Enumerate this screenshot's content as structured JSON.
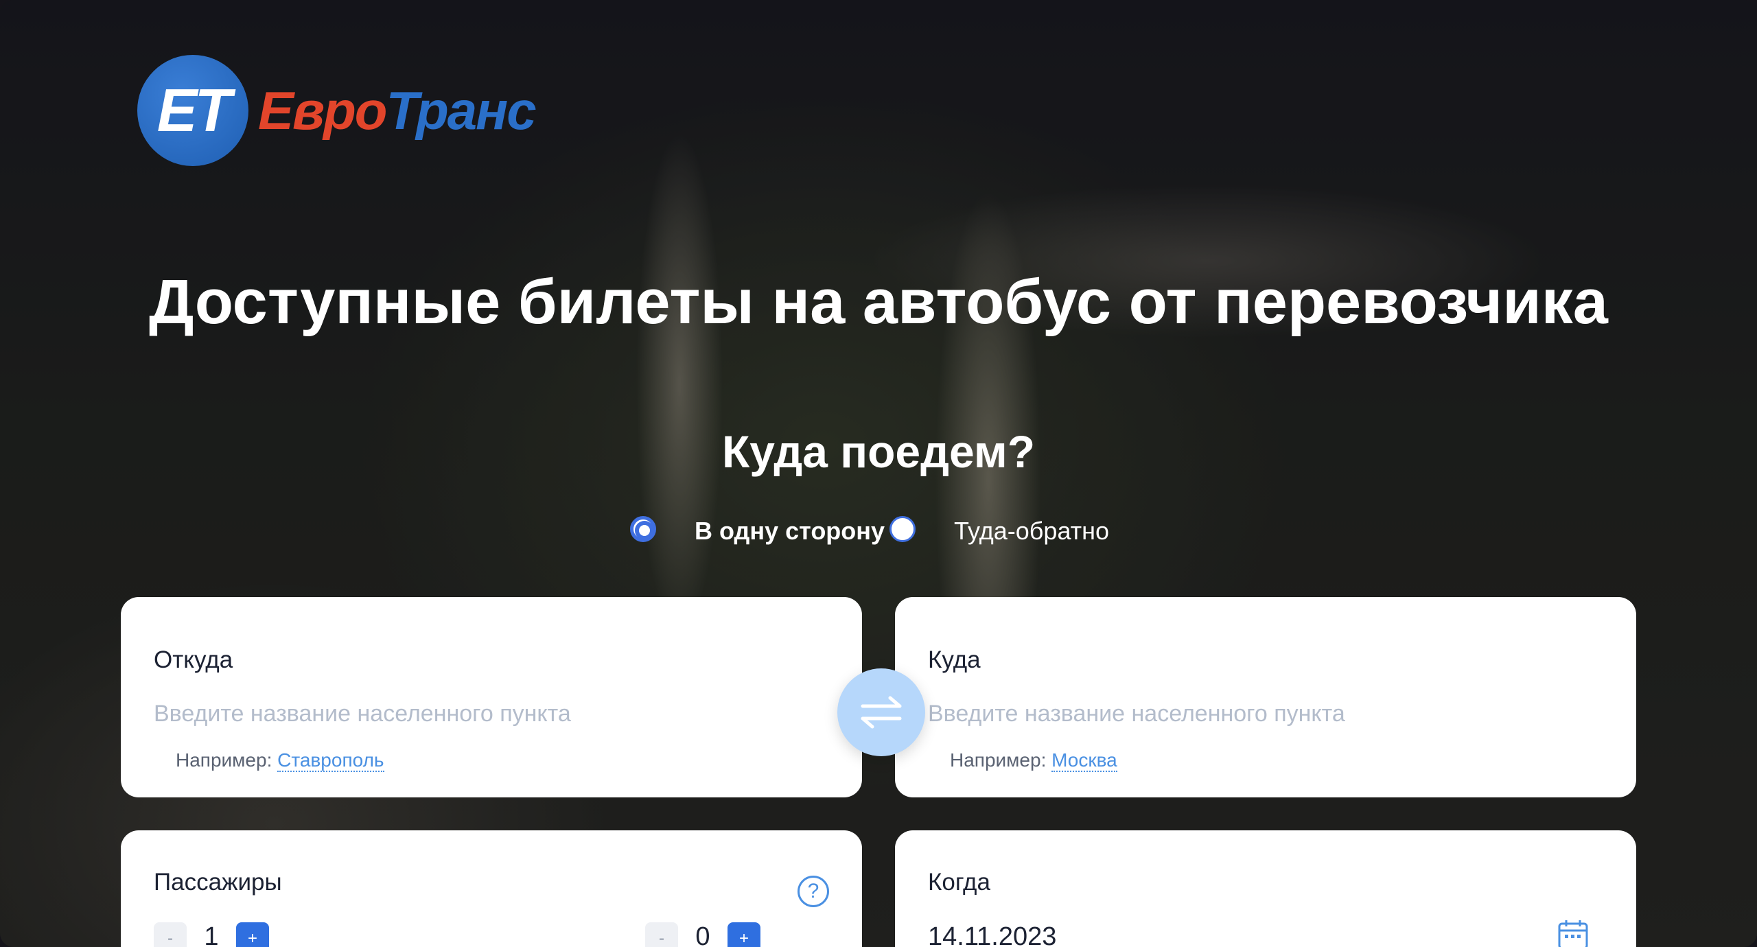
{
  "logo": {
    "badge": "ET",
    "part1": "Евро",
    "part2": "Транс"
  },
  "hero": {
    "title": "Доступные билеты на автобус от перевозчика",
    "subtitle": "Куда поедем?"
  },
  "trip_type": {
    "one_way": "В одну сторону",
    "round_trip": "Туда-обратно",
    "selected": "one_way"
  },
  "from": {
    "label": "Откуда",
    "placeholder": "Введите название населенного пункта",
    "example_prefix": "Например:",
    "example_city": "Ставрополь"
  },
  "to": {
    "label": "Куда",
    "placeholder": "Введите название населенного пункта",
    "example_prefix": "Например:",
    "example_city": "Москва"
  },
  "passengers": {
    "label": "Пассажиры",
    "adults": "1",
    "children": "0",
    "minus": "-",
    "plus": "+",
    "help": "?"
  },
  "date": {
    "label": "Когда",
    "value": "14.11.2023"
  },
  "colors": {
    "accent": "#2f6fe0",
    "swap_bg": "#b6d7fb",
    "logo_red": "#e2452b",
    "logo_blue": "#2a6fc9"
  },
  "icons": {
    "swap": "swap-arrows-icon",
    "calendar": "calendar-icon",
    "help": "help-icon"
  }
}
